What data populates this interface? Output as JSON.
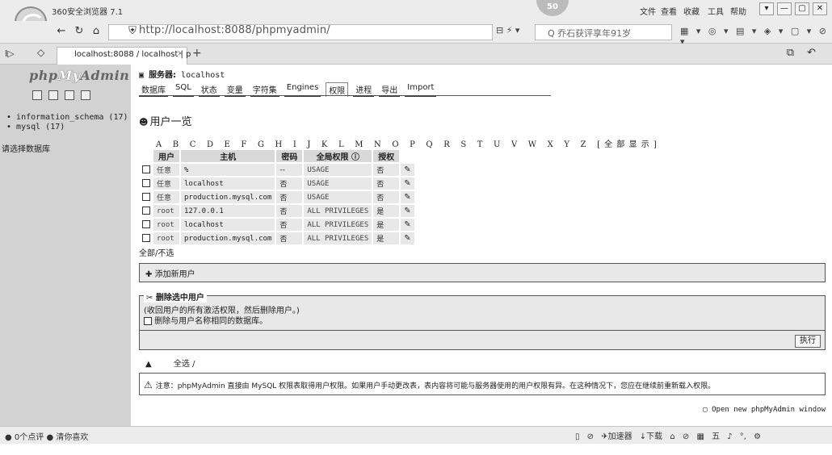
{
  "browser": {
    "app_title": "360安全浏览器 7.1",
    "center_badge": "50",
    "menu": [
      "文件",
      "查看",
      "收藏",
      "工具",
      "帮助"
    ],
    "window_controls": [
      "▾",
      "—",
      "▢",
      "✕"
    ],
    "nav": {
      "back": "←",
      "reload": "↻",
      "home": "⌂",
      "star": "☆",
      "shield": "⛨"
    },
    "url": "http://localhost:8088/phpmyadmin/",
    "url_icons": "⊟ ⚡ ▾",
    "search_text": "Q 乔石获评享年91岁",
    "search_go": "Q",
    "tools": "▦ ▾ ◎ ▾ ▤ ▾ ◈ ▾ ▢ ▾ ⊘ ▾",
    "tab_title": "localhost:8088 / localhost | p",
    "tab_close": "×",
    "new_tab": "+",
    "sidebar_toggle": "I▷",
    "tab_home": "◇",
    "tabbar_right": "⧉ ↶"
  },
  "left": {
    "logo_php": "php",
    "logo_my": "My",
    "logo_admin": "Admin",
    "databases": [
      "information_schema (17)",
      "mysql (17)"
    ],
    "select_db": "请选择数据库"
  },
  "main": {
    "server_label": "服务器:",
    "server_name": "localhost",
    "tabs": [
      "数据库",
      "SQL",
      "状态",
      "变量",
      "字符集",
      "Engines",
      "权限",
      "进程",
      "导出",
      "Import"
    ],
    "heading": "用户一览",
    "alphabet": "A B C D E F G H I J K L M N O P Q R S T U V W X Y Z",
    "show_all": "[全部显示]",
    "table": {
      "headers": [
        "用户",
        "主机",
        "密码",
        "全局权限",
        "授权"
      ],
      "rows": [
        {
          "user": "任意",
          "host": "%",
          "password": "--",
          "privileges": "USAGE",
          "grant": "否"
        },
        {
          "user": "任意",
          "host": "localhost",
          "password": "否",
          "privileges": "USAGE",
          "grant": "否"
        },
        {
          "user": "任意",
          "host": "production.mysql.com",
          "password": "否",
          "privileges": "USAGE",
          "grant": "否"
        },
        {
          "user": "root",
          "host": "127.0.0.1",
          "password": "否",
          "privileges": "ALL PRIVILEGES",
          "grant": "是"
        },
        {
          "user": "root",
          "host": "localhost",
          "password": "否",
          "privileges": "ALL PRIVILEGES",
          "grant": "是"
        },
        {
          "user": "root",
          "host": "production.mysql.com",
          "password": "否",
          "privileges": "ALL PRIVILEGES",
          "grant": "是"
        }
      ]
    },
    "select_all": "全部/不选",
    "add_user": "添加新用户",
    "remove_legend": "删除选中用户",
    "revoke_note": "(收回用户的所有激活权限，然后删除用户。)",
    "drop_db_label": "删除与用户名称相同的数据库。",
    "go_button": "执行",
    "check_all": "全选 /",
    "notice": "注意：phpMyAdmin 直接由 MySQL 权限表取得用户权限。如果用户手动更改表，表内容将可能与服务器使用的用户权限有异。在这种情况下，您应在继续前重新载入权限。",
    "open_new_window": "Open new phpMyAdmin window"
  },
  "status": {
    "left": "● 0个点评   ● 清你喜欢",
    "right": "▯ ⊘ ✈加速器 ↓下载 ⌂ ⊘ ▦ 五 ♪ °, ⚙"
  }
}
